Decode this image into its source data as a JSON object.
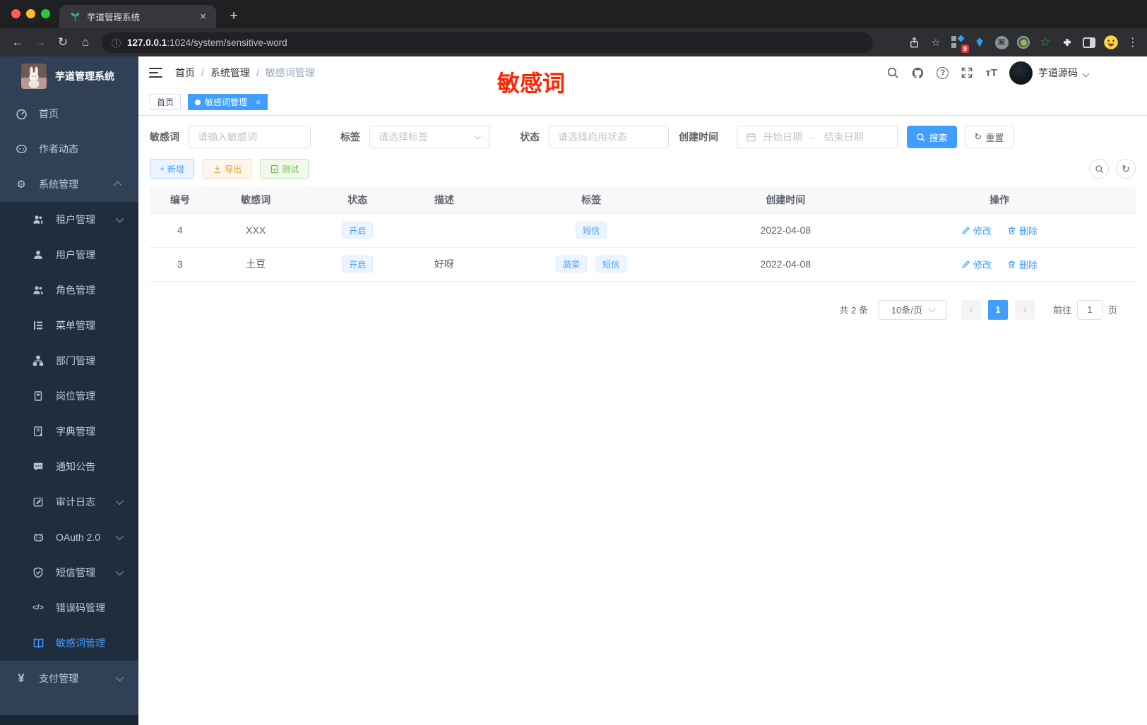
{
  "browser": {
    "tab_title": "芋道管理系统",
    "url_host": "127.0.0.1",
    "url_rest": ":1024/system/sensitive-word",
    "ext_badge": "9"
  },
  "glyphs": {
    "close": "×",
    "plus": "+",
    "back": "←",
    "forward": "→",
    "reload": "↻",
    "home": "⌂",
    "star": "☆",
    "info": "ⓘ",
    "more": "⋮",
    "command": "⌘",
    "help": "?",
    "font_size": "тT",
    "code": "</>",
    "yen": "¥",
    "gear": "⚙",
    "prev": "‹",
    "next": "›",
    "dash": "-"
  },
  "sidebar": {
    "title": "芋道管理系统",
    "items": [
      {
        "label": "首页"
      },
      {
        "label": "作者动态"
      },
      {
        "label": "系统管理"
      },
      {
        "label": "租户管理"
      },
      {
        "label": "用户管理"
      },
      {
        "label": "角色管理"
      },
      {
        "label": "菜单管理"
      },
      {
        "label": "部门管理"
      },
      {
        "label": "岗位管理"
      },
      {
        "label": "字典管理"
      },
      {
        "label": "通知公告"
      },
      {
        "label": "审计日志"
      },
      {
        "label": "OAuth 2.0"
      },
      {
        "label": "短信管理"
      },
      {
        "label": "错误码管理"
      },
      {
        "label": "敏感词管理"
      },
      {
        "label": "支付管理"
      }
    ]
  },
  "navbar": {
    "breadcrumb": [
      "首页",
      "系统管理",
      "敏感词管理"
    ],
    "username": "芋道源码"
  },
  "annotation": {
    "text": "敏感词",
    "color": "#fe2500"
  },
  "tags_view": {
    "home": "首页",
    "current": "敏感词管理"
  },
  "filters": {
    "keyword_label": "敏感词",
    "keyword_placeholder": "请输入敏感词",
    "tag_label": "标签",
    "tag_placeholder": "请选择标签",
    "status_label": "状态",
    "status_placeholder": "请选择启用状态",
    "date_label": "创建时间",
    "date_start": "开始日期",
    "date_end": "结束日期",
    "search": "搜索",
    "reset": "重置"
  },
  "toolbar": {
    "add": "新增",
    "export": "导出",
    "test": "测试"
  },
  "table": {
    "headers": [
      "编号",
      "敏感词",
      "状态",
      "描述",
      "标签",
      "创建时间",
      "操作"
    ],
    "rows": [
      {
        "id": "4",
        "word": "XXX",
        "status": "开启",
        "desc": "",
        "tags": [
          "短信"
        ],
        "created": "2022-04-08",
        "edit": "修改",
        "delete": "删除"
      },
      {
        "id": "3",
        "word": "土豆",
        "status": "开启",
        "desc": "好呀",
        "tags": [
          "蔬菜",
          "短信"
        ],
        "created": "2022-04-08",
        "edit": "修改",
        "delete": "删除"
      }
    ]
  },
  "pagination": {
    "total": "共 2 条",
    "page_size": "10条/页",
    "page": "1",
    "goto_label": "前往",
    "goto_value": "1",
    "page_unit": "页"
  },
  "colors": {
    "primary": "#409eff",
    "annotation_red": "#fe2500",
    "sidebar_bg": "#304156",
    "submenu_bg": "#1f2d3d"
  }
}
